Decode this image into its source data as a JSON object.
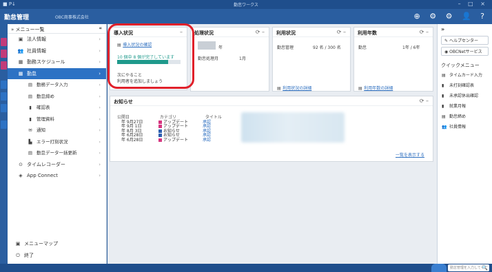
{
  "titlebar": {
    "left": "■ P↓",
    "center": "勤怠ワークス",
    "controls": "– □ ×"
  },
  "app": {
    "logo": "勤怠管理",
    "company": "OBC商事株式会社",
    "header_icons": "⊕ ⚙ ⚙ 👤 ?"
  },
  "sidebar": {
    "header": "メニュー一覧",
    "header_prefix": "»",
    "collapse": "«",
    "items": [
      {
        "icon": "▣",
        "label": "法人情報",
        "sub": false,
        "active": false
      },
      {
        "icon": "👥",
        "label": "社員情報",
        "sub": false,
        "active": false
      },
      {
        "icon": "▦",
        "label": "勤務スケジュール",
        "sub": false,
        "active": false
      },
      {
        "icon": "▦",
        "label": "勤怠",
        "sub": false,
        "active": true
      },
      {
        "icon": "▤",
        "label": "勤務データ入力",
        "sub": true,
        "active": false
      },
      {
        "icon": "▤",
        "label": "勤怠締め",
        "sub": true,
        "active": false
      },
      {
        "icon": "▮",
        "label": "確認表",
        "sub": true,
        "active": false
      },
      {
        "icon": "▮",
        "label": "管理資料",
        "sub": true,
        "active": false
      },
      {
        "icon": "✉",
        "label": "通知",
        "sub": true,
        "active": false
      },
      {
        "icon": "▙",
        "label": "エラー打刻状況",
        "sub": true,
        "active": false
      },
      {
        "icon": "▤",
        "label": "勤怠データ一括更新",
        "sub": true,
        "active": false
      },
      {
        "icon": "⊙",
        "label": "タイムレコーダー",
        "sub": false,
        "active": false
      },
      {
        "icon": "◈",
        "label": "App Connect",
        "sub": false,
        "active": false
      }
    ],
    "bottom": [
      {
        "icon": "▣",
        "label": "メニューマップ"
      },
      {
        "icon": "⏻",
        "label": "終了"
      }
    ]
  },
  "intro": {
    "title": "導入状況",
    "control": "–",
    "link": "導入状況の確認",
    "progress_text": "10 個中 8 個が完了しています",
    "progress_fraction": 0.8,
    "next_label": "次にやること",
    "next_task": "利用者を追加しましょう"
  },
  "processing": {
    "title": "処理状況",
    "controls": "⟳ –",
    "year_suffix": "年",
    "period_label": "勤怠処理月",
    "period_value": "1月"
  },
  "usage": {
    "title": "利用状況",
    "controls": "⟳ –",
    "row_label": "勤怠管理",
    "row_value": "92 名 / 300 名",
    "link": "利用状況の詳細"
  },
  "contract": {
    "title": "利用年数",
    "controls": "⟳ –",
    "row_label": "勤怠",
    "row_value": "1年 / 6年",
    "link": "利用年数の詳細"
  },
  "news": {
    "title": "お知らせ",
    "controls": "⟳ –",
    "headers": [
      "公開日",
      "カテゴリ",
      "タイトル"
    ],
    "rows": [
      {
        "date": "年 9月27日",
        "color": "#d6357f",
        "category": "アップデート",
        "title": "承認"
      },
      {
        "date": "年 9月 1日",
        "color": "#d6357f",
        "category": "アップデート",
        "title": "承認"
      },
      {
        "date": "年 8月 3日",
        "color": "#2d5fb0",
        "category": "お知らせ",
        "title": "承認"
      },
      {
        "date": "年 6月28日",
        "color": "#2d5fb0",
        "category": "お知らせ",
        "title": "承認"
      },
      {
        "date": "年 6月28日",
        "color": "#d6357f",
        "category": "アップデート",
        "title": "承認"
      }
    ],
    "more_link": "一覧を表示する"
  },
  "right_panel": {
    "header": "»",
    "buttons": [
      "ヘルプセンター",
      "OBCNetサービス"
    ],
    "button_icons": [
      "✎",
      "◉"
    ],
    "quick_label": "クイックメニュー",
    "items": [
      {
        "icon": "▤",
        "label": "タイムカード入力"
      },
      {
        "icon": "▮",
        "label": "未打刻確認表"
      },
      {
        "icon": "▮",
        "label": "未承認休出確認"
      },
      {
        "icon": "▮",
        "label": "就業月報"
      },
      {
        "icon": "▤",
        "label": "勤怠締め"
      },
      {
        "icon": "👥",
        "label": "社員情報"
      }
    ]
  },
  "statusbar": {
    "search_placeholder": "勤怠管理を入力してください",
    "search_icon": "🔍"
  },
  "colors": {
    "accent": "#2d72c4",
    "highlight": "#e0202a",
    "progress": "#1f9a8c"
  }
}
